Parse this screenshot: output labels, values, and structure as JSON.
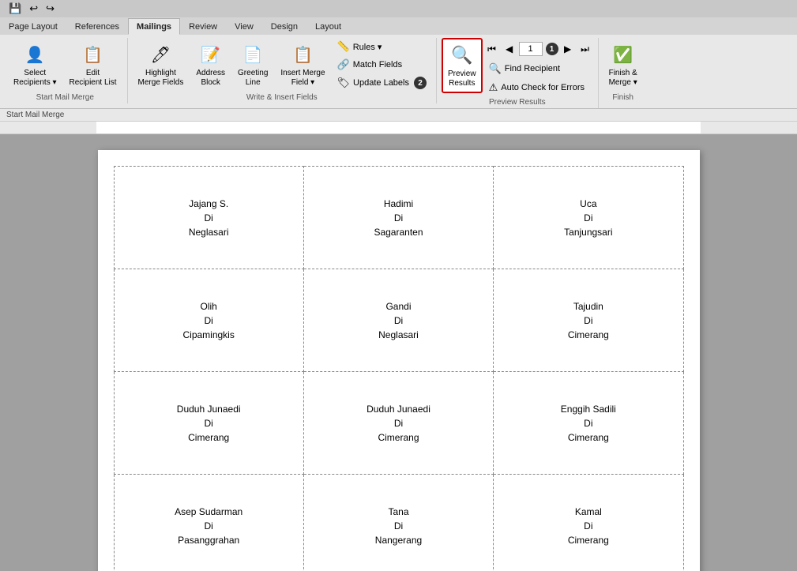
{
  "tabs": [
    {
      "id": "page-layout",
      "label": "Page Layout",
      "active": false
    },
    {
      "id": "references",
      "label": "References",
      "active": false
    },
    {
      "id": "mailings",
      "label": "Mailings",
      "active": true
    },
    {
      "id": "review",
      "label": "Review",
      "active": false
    },
    {
      "id": "view",
      "label": "View",
      "active": false
    },
    {
      "id": "design",
      "label": "Design",
      "active": false
    },
    {
      "id": "layout",
      "label": "Layout",
      "active": false
    }
  ],
  "ribbon": {
    "groups": [
      {
        "id": "start-mail-merge",
        "label": "Start Mail Merge",
        "buttons": [
          {
            "id": "select-recipients",
            "label": "Select\nRecipients ▾",
            "type": "large",
            "icon": "👤"
          },
          {
            "id": "edit-recipient-list",
            "label": "Edit\nRecipient List",
            "type": "large",
            "icon": "📋"
          }
        ]
      },
      {
        "id": "write-insert-fields",
        "label": "Write & Insert Fields",
        "buttons": [
          {
            "id": "highlight-merge-fields",
            "label": "Highlight\nMerge Fields",
            "type": "large",
            "icon": "🖊"
          },
          {
            "id": "address-block",
            "label": "Address\nBlock",
            "type": "large",
            "icon": "📝"
          },
          {
            "id": "greeting-line",
            "label": "Greeting\nLine",
            "type": "large",
            "icon": "📄"
          },
          {
            "id": "insert-merge-field",
            "label": "Insert Merge\nField ▾",
            "type": "large",
            "icon": "📋"
          },
          {
            "id": "rules",
            "label": "Rules ▾",
            "type": "small-top",
            "icon": "📏"
          },
          {
            "id": "match-fields",
            "label": "Match Fields",
            "type": "small",
            "icon": "🔗"
          },
          {
            "id": "update-labels",
            "label": "Update Labels",
            "type": "small",
            "icon": "🏷"
          }
        ]
      },
      {
        "id": "preview-results-group",
        "label": "Preview Results",
        "buttons": [
          {
            "id": "preview-results",
            "label": "Preview\nResults",
            "type": "large",
            "icon": "🔍",
            "highlighted": true
          },
          {
            "id": "find-recipient",
            "label": "Find Recipient",
            "type": "small",
            "icon": "🔍"
          },
          {
            "id": "auto-check-errors",
            "label": "Auto Check for Errors",
            "type": "small",
            "icon": "⚠"
          }
        ],
        "nav": {
          "prev_prev": "⏮",
          "prev": "◀",
          "value": "1",
          "next": "▶",
          "next_next": "⏭"
        }
      },
      {
        "id": "finish",
        "label": "Finish",
        "buttons": [
          {
            "id": "finish-merge",
            "label": "Finish &\nMerge ▾",
            "type": "large",
            "icon": "✅"
          }
        ]
      }
    ]
  },
  "status_bar": {
    "text": "Start Mail Merge"
  },
  "step_badges": {
    "update_labels": "2",
    "preview_results_nav": "1"
  },
  "label_data": {
    "rows": [
      [
        {
          "name": "Jajang S.",
          "di": "Di",
          "place": "Neglasari"
        },
        {
          "name": "Hadimi",
          "di": "Di",
          "place": "Sagaranten"
        },
        {
          "name": "Uca",
          "di": "Di",
          "place": "Tanjungsari"
        }
      ],
      [
        {
          "name": "Olih",
          "di": "Di",
          "place": "Cipamingkis"
        },
        {
          "name": "Gandi",
          "di": "Di",
          "place": "Neglasari"
        },
        {
          "name": "Tajudin",
          "di": "Di",
          "place": "Cimerang"
        }
      ],
      [
        {
          "name": "Duduh Junaedi",
          "di": "Di",
          "place": "Cimerang"
        },
        {
          "name": "Duduh Junaedi",
          "di": "Di",
          "place": "Cimerang"
        },
        {
          "name": "Enggih Sadili",
          "di": "Di",
          "place": "Cimerang"
        }
      ],
      [
        {
          "name": "Asep Sudarman",
          "di": "Di",
          "place": "Pasanggrahan"
        },
        {
          "name": "Tana",
          "di": "Di",
          "place": "Nangerang"
        },
        {
          "name": "Kamal",
          "di": "Di",
          "place": "Cimerang"
        }
      ]
    ]
  }
}
